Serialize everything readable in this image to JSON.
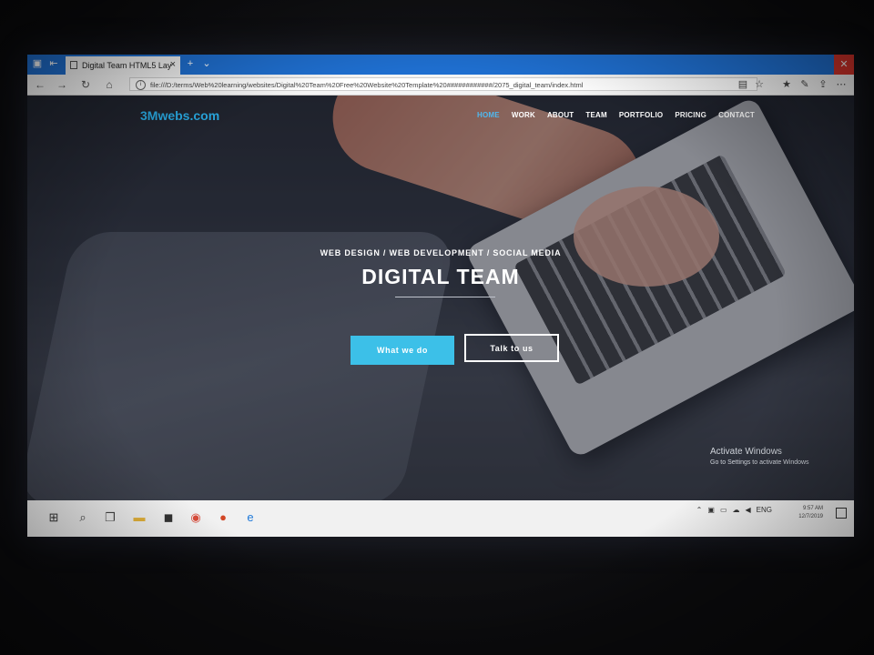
{
  "browser": {
    "tab_title": "Digital Team HTML5 Lay",
    "tab_close": "×",
    "new_tab": "+",
    "tab_menu": "⌄",
    "window_close": "✕",
    "url": "file:///D:/terms/Web%20learning/websites/Digital%20Team%20Free%20Website%20Template%20############/2075_digital_team/index.html",
    "back": "←",
    "forward": "→",
    "refresh": "↻",
    "home": "⌂"
  },
  "site": {
    "brand": "3Mwebs.com",
    "nav": [
      "HOME",
      "WORK",
      "ABOUT",
      "TEAM",
      "PORTFOLIO",
      "PRICING",
      "CONTACT"
    ],
    "active_nav": "HOME",
    "subtitle": "WEB DESIGN / WEB DEVELOPMENT / SOCIAL MEDIA",
    "headline": "DIGITAL TEAM",
    "primary_button": "What we do",
    "secondary_button": "Talk to us",
    "colors": {
      "brand": "#29a8e0",
      "primary_button": "#3cc0e8",
      "active_nav": "#4fb9f0"
    }
  },
  "activation": {
    "title": "Activate Windows",
    "subtitle": "Go to Settings to activate Windows"
  },
  "taskbar": {
    "start": "⊞",
    "apps": [
      "search-icon",
      "task-view-icon",
      "file-explorer-icon",
      "store-icon",
      "chrome-icon",
      "powerpoint-icon",
      "edge-icon"
    ],
    "language": "ENG",
    "time": "9:57 AM",
    "date": "12/7/2019"
  }
}
